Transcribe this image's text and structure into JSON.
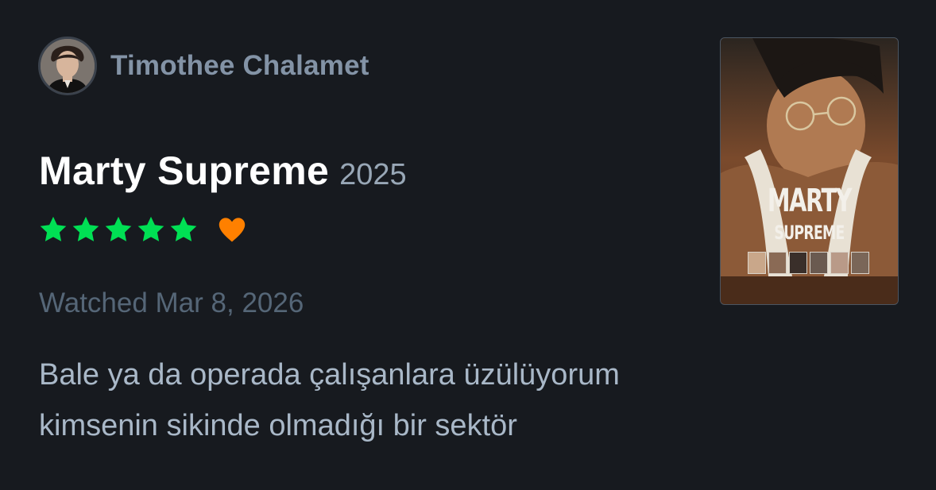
{
  "author": {
    "name": "Timothee Chalamet",
    "avatar_icon": "user-avatar"
  },
  "film": {
    "title": "Marty Supreme",
    "year": "2025",
    "poster_title_line1": "MARTY",
    "poster_title_line2": "SUPREME"
  },
  "rating": {
    "stars": 5,
    "max_stars": 5,
    "star_color": "#00e054",
    "liked": true,
    "heart_color": "#ff8000",
    "star_icon": "star-icon",
    "heart_icon": "heart-icon"
  },
  "watched": {
    "label": "Watched Mar 8, 2026"
  },
  "review": {
    "line1": "Bale ya da operada çalışanlara üzülüyorum",
    "line2": "kimsenin sikinde olmadığı bir sektör"
  },
  "colors": {
    "background": "#171a1f",
    "author_text": "#8393a6",
    "title_text": "#ffffff",
    "year_text": "#98a7b6",
    "watched_text": "#556677",
    "review_text": "#a9b8c8"
  }
}
